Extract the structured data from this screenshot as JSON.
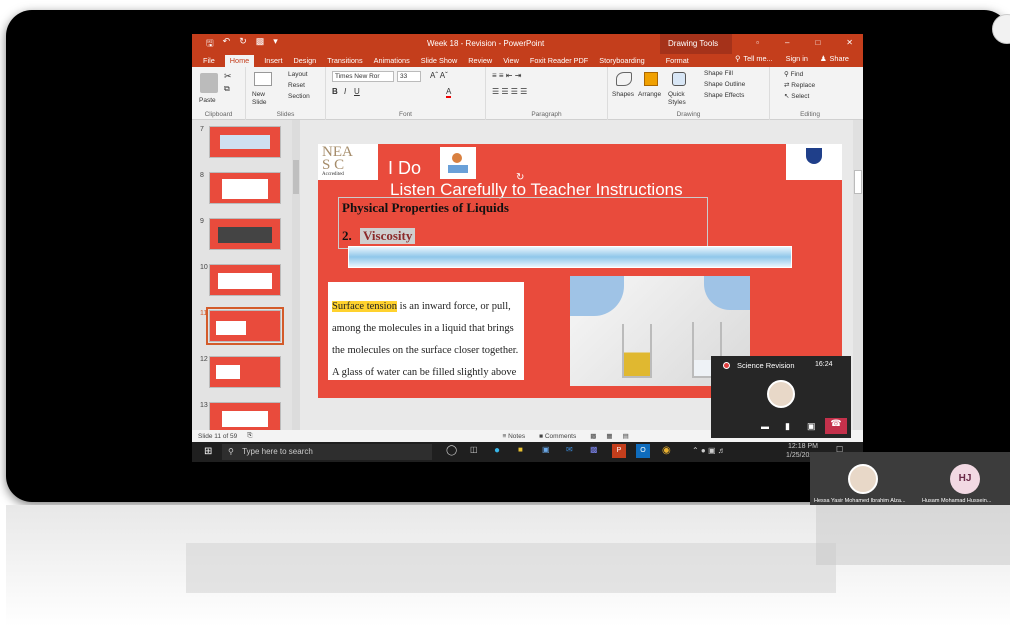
{
  "window": {
    "title": "Week 18 - Revision - PowerPoint",
    "drawing_tools": "Drawing Tools"
  },
  "tabs": [
    "File",
    "Home",
    "Insert",
    "Design",
    "Transitions",
    "Animations",
    "Slide Show",
    "Review",
    "View",
    "Foxit Reader PDF",
    "Storyboarding",
    "Format"
  ],
  "active_tab": "Home",
  "tell_me": "Tell me...",
  "sign_in": "Sign in",
  "share": "Share",
  "ribbon": {
    "clipboard": {
      "paste": "Paste",
      "label": "Clipboard"
    },
    "slides": {
      "new_slide": "New Slide",
      "layout": "Layout",
      "reset": "Reset",
      "section": "Section",
      "label": "Slides"
    },
    "font": {
      "name": "Times New Ror",
      "size": "33",
      "label": "Font"
    },
    "paragraph": {
      "label": "Paragraph"
    },
    "drawing": {
      "shapes": "Shapes",
      "arrange": "Arrange",
      "quick_styles": "Quick Styles",
      "shape_fill": "Shape Fill",
      "shape_outline": "Shape Outline",
      "shape_effects": "Shape Effects",
      "label": "Drawing"
    },
    "editing": {
      "find": "Find",
      "replace": "Replace",
      "select": "Select",
      "label": "Editing"
    }
  },
  "thumbnails": [
    {
      "num": "7"
    },
    {
      "num": "8"
    },
    {
      "num": "9"
    },
    {
      "num": "10"
    },
    {
      "num": "11"
    },
    {
      "num": "12"
    },
    {
      "num": "13"
    }
  ],
  "slide": {
    "i_do": "I Do",
    "instruction": "Listen Carefully to Teacher Instructions",
    "heading": "Physical Properties of Liquids",
    "item_num": "2.",
    "item": "Viscosity",
    "term": "Surface tension",
    "body": " is an inward force, or pull, among the molecules in a liquid that brings the molecules on the surface closer together. A glass of water can be filled slightly above",
    "logo_line1": "NEA",
    "logo_line2": "S C",
    "logo_sub": "Accredited"
  },
  "status": {
    "slide_info": "Slide 11 of 59",
    "notes": "Notes",
    "comments": "Comments"
  },
  "taskbar": {
    "search_placeholder": "Type here to search",
    "time": "12:18 PM",
    "date": "1/25/2021"
  },
  "meeting": {
    "title": "Science Revision",
    "timer": "16:24"
  },
  "participants": [
    {
      "initials": "",
      "name": "Hessa Yasir Mohamed Ibrahim Alza..."
    },
    {
      "initials": "HJ",
      "name": "Husam Mohamad Hussein..."
    }
  ],
  "colors": {
    "ppt_red": "#c43e1c",
    "slide_red": "#e94b3c",
    "highlight": "#ffd22e"
  }
}
